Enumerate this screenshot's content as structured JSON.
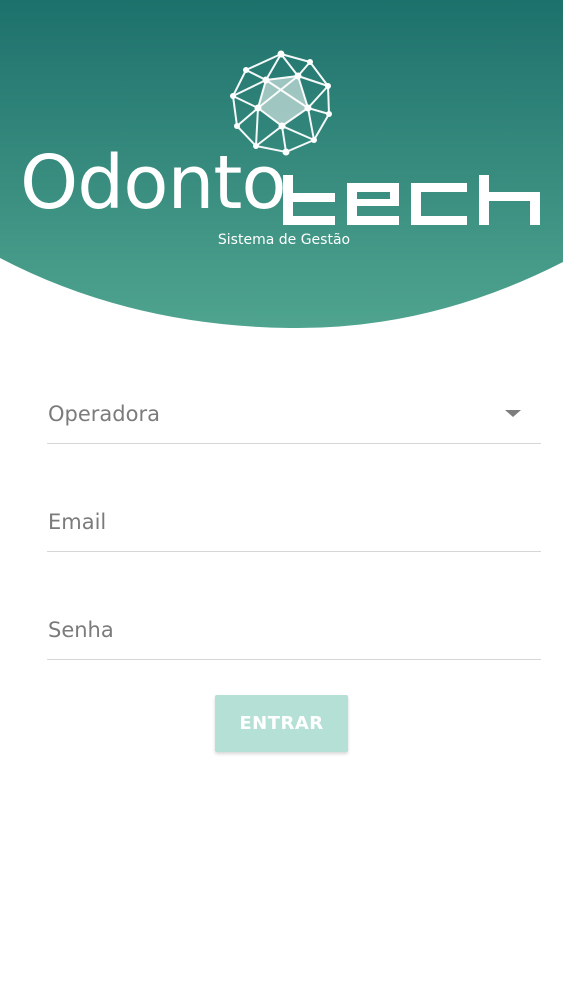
{
  "brand": {
    "name_prefix": "Odonto",
    "name_suffix": "tech",
    "tagline": "Sistema de Gestão",
    "logo_icon": "network-sphere-icon"
  },
  "theme": {
    "header_top": "#1d716c",
    "header_bottom": "#4fa48f",
    "button_bg": "#b5e0d6",
    "button_text": "#ffffff",
    "label_text": "#7b7b7b",
    "divider": "#d6d6d6"
  },
  "form": {
    "operadora_label": "Operadora",
    "email_label": "Email",
    "senha_label": "Senha",
    "submit_label": "ENTRAR"
  }
}
